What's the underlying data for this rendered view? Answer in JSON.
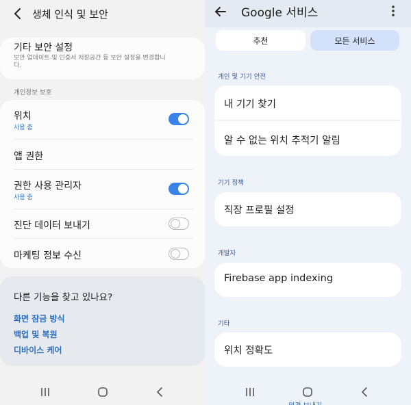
{
  "left": {
    "header": {
      "title": "생체 인식 및 보안"
    },
    "other_security": {
      "title": "기타 보안 설정",
      "desc": "보안 업데이트 및 인증서 저장공간 등 보안 설정을 변경합니다."
    },
    "privacy_section_label": "개인정보 보호",
    "privacy_items": [
      {
        "title": "위치",
        "sub": "사용 중",
        "toggle": "on"
      },
      {
        "title": "앱 권한"
      },
      {
        "title": "권한 사용 관리자",
        "sub": "사용 중",
        "toggle": "on"
      },
      {
        "title": "진단 데이터 보내기",
        "toggle": "off"
      },
      {
        "title": "마케팅 정보 수신",
        "toggle": "off"
      }
    ],
    "search_card": {
      "title": "다른 기능을 찾고 있나요?",
      "links": [
        "화면 잠금 방식",
        "백업 및 복원",
        "디바이스 케어"
      ]
    }
  },
  "right": {
    "header": {
      "title": "Google 서비스"
    },
    "tabs": [
      "추천",
      "모든 서비스"
    ],
    "sections": [
      {
        "label": "개인 및 기기 안전",
        "items": [
          "내 기기 찾기",
          "알 수 없는 위치 추적기 알림"
        ]
      },
      {
        "label": "기기 정책",
        "items": [
          "직장 프로필 설정"
        ]
      },
      {
        "label": "개발자",
        "items": [
          "Firebase app indexing"
        ]
      },
      {
        "label": "기타",
        "items": [
          "위치 정확도"
        ]
      }
    ],
    "bottom_text": "의견 보내기"
  },
  "colors": {
    "accent_blue": "#3b82e8",
    "link_blue": "#2a6cc0",
    "selected_tab": "#d3e1fb"
  },
  "icons": [
    "back-arrow-icon",
    "more-vert-icon",
    "recents-icon",
    "home-icon",
    "nav-back-icon"
  ]
}
